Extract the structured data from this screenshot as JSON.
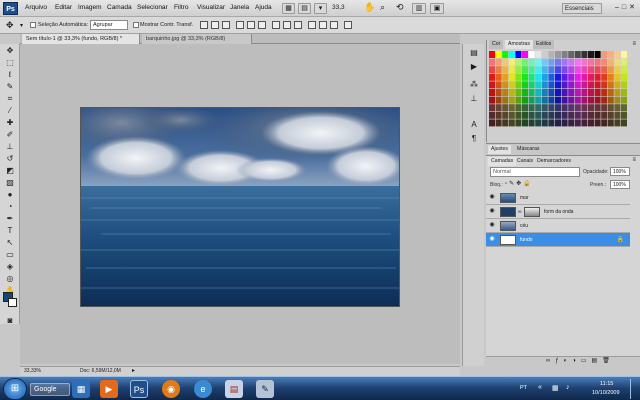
{
  "app": {
    "logo": "Ps",
    "essenciais": "Essenciais",
    "zoom": "33,3"
  },
  "menu": [
    "Arquivo",
    "Editar",
    "Imagem",
    "Camada",
    "Selecionar",
    "Filtro",
    "Visualizar",
    "Janela",
    "Ajuda"
  ],
  "options": {
    "auto_select_label": "Seleção Automática:",
    "auto_select_value": "Agrupar",
    "transform_label": "Mostrar Contr. Transf."
  },
  "tabs": [
    "Sem título-1 @ 33,3% (fundo, RGB/8) *",
    "barquinho.jpg @ 33,3% (RGB/8)"
  ],
  "status": {
    "zoom": "33,33%",
    "doc": "Doc: 6,59M/12,0M"
  },
  "swatch_panel": {
    "tabs": [
      "Cor",
      "Amostras",
      "Estilos"
    ]
  },
  "adj_panel": {
    "tabs": [
      "Ajustes",
      "Máscaras"
    ]
  },
  "layers_panel": {
    "tabs": [
      "Camadas",
      "Canais",
      "Demarcadores"
    ],
    "blend_mode": "Normal",
    "opacity_label": "Opacidade:",
    "opacity_value": "100%",
    "lock_label": "Bloq.:",
    "fill_label": "Preen.:",
    "fill_value": "100%",
    "layers": [
      {
        "name": "mar",
        "visible": true,
        "selected": false
      },
      {
        "name": "",
        "mask_name": "form da onda",
        "visible": true,
        "selected": false
      },
      {
        "name": "céu",
        "visible": true,
        "selected": false
      },
      {
        "name": "fundo",
        "visible": true,
        "selected": true,
        "locked": true
      }
    ]
  },
  "taskbar": {
    "search": "Google",
    "lang": "PT",
    "time": "11:15",
    "date": "10/10/2009"
  },
  "colors": {
    "accent": "#3a8ee6",
    "foreground": "#0f4a78",
    "background": "#ffffff"
  }
}
